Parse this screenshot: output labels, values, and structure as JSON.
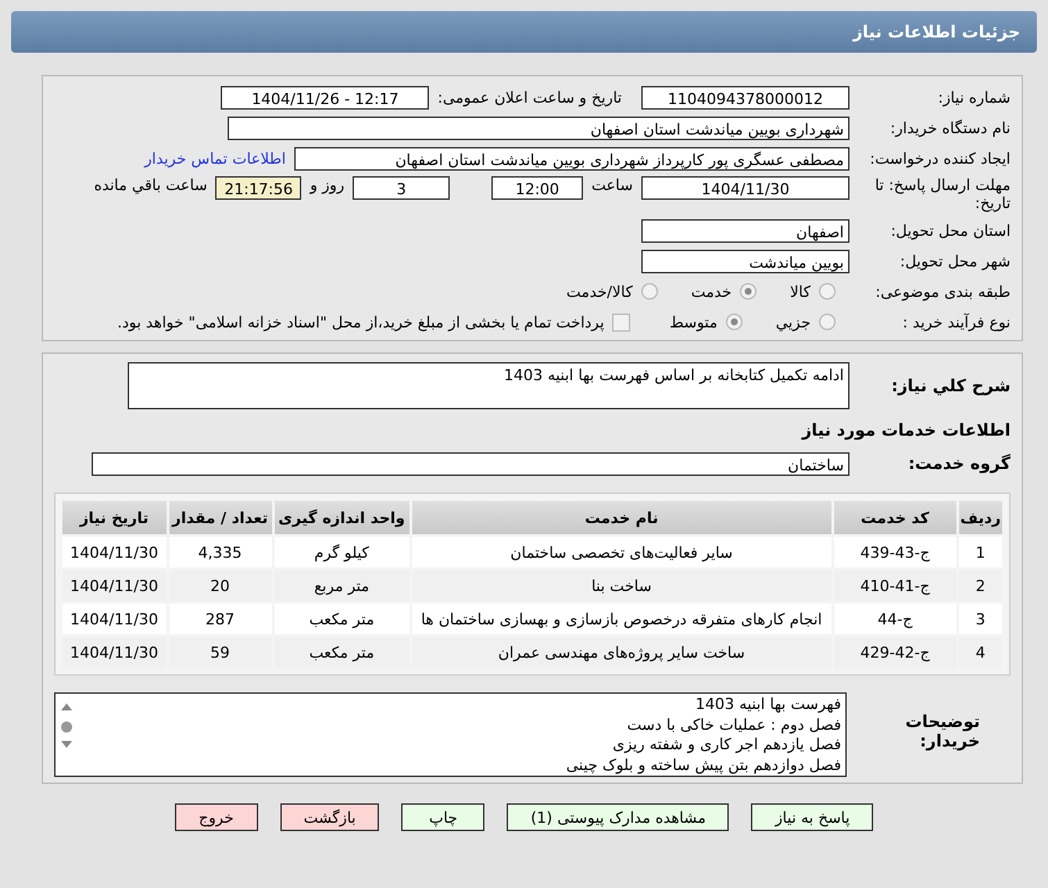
{
  "header": {
    "title": "جزئیات اطلاعات نیاز"
  },
  "details": {
    "need_number": {
      "label": "شماره نیاز:",
      "value": "1104094378000012"
    },
    "announce": {
      "label": "تاریخ و ساعت اعلان عمومی:",
      "value": "1404/11/26 - 12:17"
    },
    "buyer": {
      "label": "نام دستگاه خریدار:",
      "value": "شهرداری بویین میاندشت استان اصفهان"
    },
    "creator": {
      "label": "ایجاد کننده درخواست:",
      "value": "مصطفی عسگری پور کارپرداز شهرداری بویین میاندشت استان اصفهان",
      "link": "اطلاعات تماس خریدار"
    },
    "deadline": {
      "label": "مهلت ارسال پاسخ: تا تاریخ:",
      "date": "1404/11/30",
      "time_label": "ساعت",
      "time": "12:00",
      "days": "3",
      "days_label": "روز و",
      "remaining": "21:17:56",
      "remaining_label": "ساعت باقي مانده"
    },
    "province": {
      "label": "استان محل تحویل:",
      "value": "اصفهان"
    },
    "city": {
      "label": "شهر محل تحویل:",
      "value": "بویین میاندشت"
    },
    "category": {
      "label": "طبقه بندی موضوعی:",
      "options": [
        {
          "label": "کالا",
          "selected": false
        },
        {
          "label": "خدمت",
          "selected": true
        },
        {
          "label": "کالا/خدمت",
          "selected": false
        }
      ]
    },
    "process": {
      "label": "نوع فرآیند خرید :",
      "options": [
        {
          "label": "جزیي",
          "selected": false
        },
        {
          "label": "متوسط",
          "selected": true
        }
      ],
      "payment": {
        "checked": false,
        "text": "پرداخت تمام یا بخشی از مبلغ خرید،از محل \"اسناد خزانه اسلامی\" خواهد بود."
      }
    }
  },
  "services": {
    "description": {
      "label": "شرح کلي نیاز:",
      "value": "ادامه تکمیل کتابخانه بر اساس فهرست بها ابنیه 1403"
    },
    "heading": "اطلاعات خدمات مورد نیاز",
    "group": {
      "label": "گروه خدمت:",
      "value": "ساختمان"
    },
    "table": {
      "columns": [
        "ردیف",
        "کد خدمت",
        "نام خدمت",
        "واحد اندازه گیری",
        "تعداد / مقدار",
        "تاریخ نیاز"
      ],
      "rows": [
        [
          "1",
          "ج-43-439",
          "سایر فعالیت‌های تخصصی ساختمان",
          "کیلو گرم",
          "4,335",
          "1404/11/30"
        ],
        [
          "2",
          "ج-41-410",
          "ساخت بنا",
          "متر مربع",
          "20",
          "1404/11/30"
        ],
        [
          "3",
          "ج-44",
          "انجام کارهای متفرقه درخصوص بازسازی و بهسازی ساختمان ها",
          "متر مکعب",
          "287",
          "1404/11/30"
        ],
        [
          "4",
          "ج-42-429",
          "ساخت سایر پروژه‌های مهندسی عمران",
          "متر مکعب",
          "59",
          "1404/11/30"
        ]
      ]
    },
    "notes": {
      "label": "توضیحات خریدار:",
      "lines": [
        "فهرست بها ابنیه 1403",
        "فصل دوم : عملیات خاکی با دست",
        "فصل یازدهم اجر کاری و شفته ریزی",
        "فصل دوازدهم بتن پیش ساخته و بلوک چینی"
      ]
    }
  },
  "buttons": [
    {
      "label": "پاسخ به نیاز",
      "kind": "normal"
    },
    {
      "label": "مشاهده مدارک پیوستی (1)",
      "kind": "normal"
    },
    {
      "label": "چاپ",
      "kind": "normal"
    },
    {
      "label": "بازگشت",
      "kind": "danger"
    },
    {
      "label": "خروج",
      "kind": "danger"
    }
  ]
}
